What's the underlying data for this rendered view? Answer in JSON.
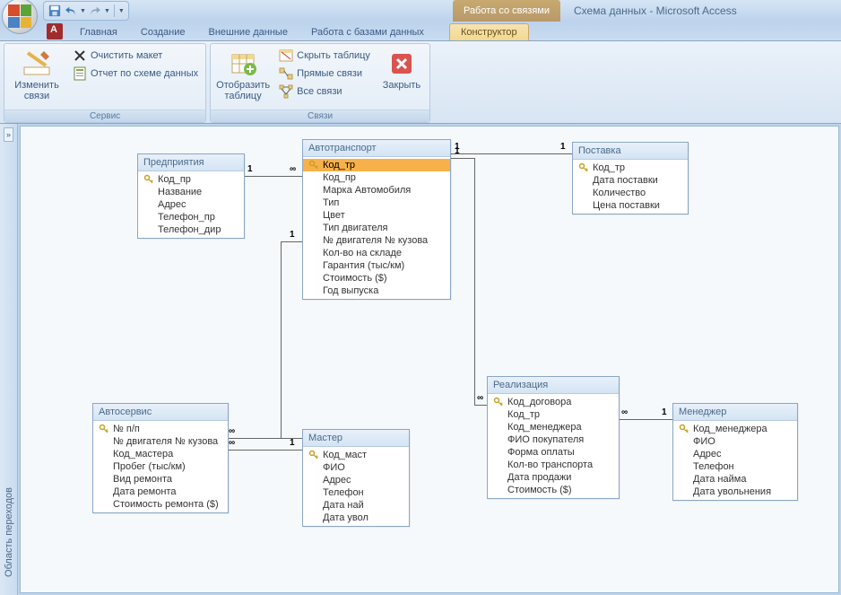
{
  "contextual_tab_group": "Работа со связями",
  "app_title": "Схема данных - Microsoft Access",
  "tabs": {
    "home": "Главная",
    "create": "Создание",
    "external": "Внешние данные",
    "dbtools": "Работа с базами данных",
    "designer": "Конструктор"
  },
  "ribbon": {
    "edit_relations": "Изменить связи",
    "clear_layout": "Очистить макет",
    "schema_report": "Отчет по схеме данных",
    "group_service": "Сервис",
    "show_table": "Отобразить таблицу",
    "hide_table": "Скрыть таблицу",
    "direct_relations": "Прямые связи",
    "all_relations": "Все связи",
    "group_relations": "Связи",
    "close": "Закрыть"
  },
  "side_pane": {
    "expand_tooltip": "»",
    "label": "Область переходов"
  },
  "tables": {
    "enterprise": {
      "title": "Предприятия",
      "fields": [
        "Код_пр",
        "Название",
        "Адрес",
        "Телефон_пр",
        "Телефон_дир"
      ],
      "pk": [
        0
      ]
    },
    "autotransport": {
      "title": "Автотранспорт",
      "fields": [
        "Код_тр",
        "Код_пр",
        "Марка Автомобиля",
        "Тип",
        "Цвет",
        "Тип двигателя",
        "№ двигателя № кузова",
        "Кол-во на складе",
        "Гарантия  (тыс/км)",
        "Стоимость ($)",
        "Год выпуска"
      ],
      "pk": [
        0
      ]
    },
    "supply": {
      "title": "Поставка",
      "fields": [
        "Код_тр",
        "Дата поставки",
        "Количество",
        "Цена поставки"
      ],
      "pk": [
        0
      ]
    },
    "autoservice": {
      "title": "Автосервис",
      "fields": [
        "№ п/п",
        "№ двигателя № кузова",
        "Код_мастера",
        "Пробег (тыс/км)",
        "Вид ремонта",
        "Дата ремонта",
        "Стоимость ремонта ($)"
      ],
      "pk": [
        0
      ]
    },
    "master": {
      "title": "Мастер",
      "fields": [
        "Код_маст",
        "ФИО",
        "Адрес",
        "Телефон",
        "Дата най",
        "Дата увол"
      ],
      "pk": [
        0
      ]
    },
    "realization": {
      "title": "Реализация",
      "fields": [
        "Код_договора",
        "Код_тр",
        "Код_менеджера",
        "ФИО покупателя",
        "Форма оплаты",
        "Кол-во транспорта",
        "Дата продажи",
        "Стоимость ($)"
      ],
      "pk": [
        0
      ]
    },
    "manager": {
      "title": "Менеджер",
      "fields": [
        "Код_менеджера",
        "ФИО",
        "Адрес",
        "Телефон",
        "Дата найма",
        "Дата увольнения"
      ],
      "pk": [
        0
      ]
    }
  },
  "rel_labels": {
    "one": "1",
    "many": "∞"
  }
}
